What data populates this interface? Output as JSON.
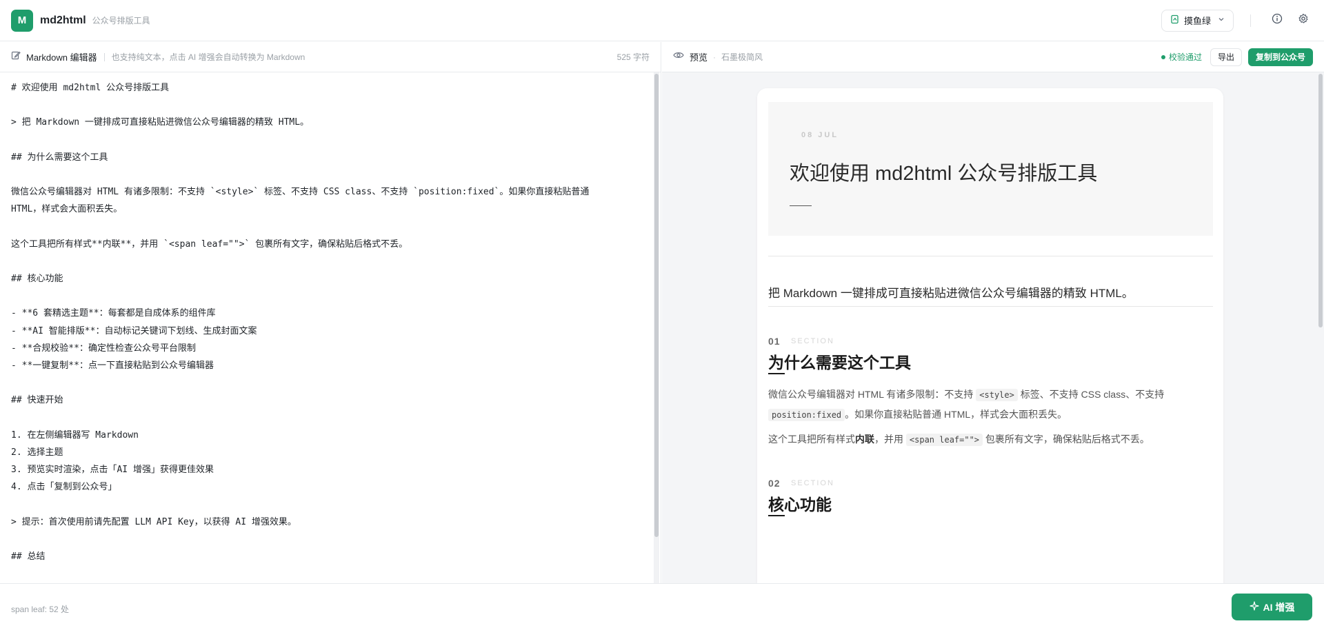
{
  "app": {
    "logo_letter": "M",
    "name": "md2html",
    "subtitle": "公众号排版工具"
  },
  "topbar": {
    "theme_label": "摸鱼绿",
    "icons": [
      "theme-palette-icon",
      "chevron-down-icon",
      "info-icon",
      "gear-icon"
    ]
  },
  "editor": {
    "title": "Markdown 编辑器",
    "hint": "也支持纯文本，点击 AI 增强会自动转换为 Markdown",
    "char_count": "525 字符",
    "lines": [
      "# 欢迎使用 md2html 公众号排版工具",
      "",
      "> 把 Markdown 一键排成可直接粘贴进微信公众号编辑器的精致 HTML。",
      "",
      "## 为什么需要这个工具",
      "",
      "微信公众号编辑器对 HTML 有诸多限制：不支持 `<style>` 标签、不支持 CSS class、不支持 `position:fixed`。如果你直接粘贴普通",
      "HTML，样式会大面积丢失。",
      "",
      "这个工具把所有样式**内联**，并用 `<span leaf=\"\">` 包裹所有文字，确保粘贴后格式不丢。",
      "",
      "## 核心功能",
      "",
      "- **6 套精选主题**：每套都是自成体系的组件库",
      "- **AI 智能排版**：自动标记关键词下划线、生成封面文案",
      "- **合规校验**：确定性检查公众号平台限制",
      "- **一键复制**：点一下直接粘贴到公众号编辑器",
      "",
      "## 快速开始",
      "",
      "1. 在左侧编辑器写 Markdown",
      "2. 选择主题",
      "3. 预览实时渲染，点击「AI 增强」获得更佳效果",
      "4. 点击「复制到公众号」",
      "",
      "> 提示：首次使用前请先配置 LLM API Key，以获得 AI 增强效果。",
      "",
      "## 总结"
    ]
  },
  "preview": {
    "title": "预览",
    "theme_name": "石墨极简风",
    "validation": "校验通过",
    "export_label": "导出",
    "copy_label": "复制到公众号",
    "article": {
      "date": "08 JUL",
      "title": "欢迎使用 md2html 公众号排版工具",
      "lead": "把 Markdown 一键排成可直接粘贴进微信公众号编辑器的精致 HTML。",
      "sections": [
        {
          "num": "01",
          "tag": "SECTION",
          "title": "为什么需要这个工具",
          "p1_a": "微信公众号编辑器对 HTML 有诸多限制：不支持 ",
          "p1_code1": "<style>",
          "p1_b": " 标签、不支持 CSS class、不支持",
          "p1_code2": "position:fixed",
          "p1_c": "。如果你直接粘贴普通 HTML，样式会大面积丢失。",
          "p2_a": "这个工具把所有样式",
          "p2_bold": "内联",
          "p2_b": "，并用 ",
          "p2_code": "<span leaf=\"\">",
          "p2_c": " 包裹所有文字，确保粘贴后格式不丢。"
        },
        {
          "num": "02",
          "tag": "SECTION",
          "title": "核心功能"
        }
      ]
    }
  },
  "footer": {
    "status": "span leaf: 52 处",
    "ai_label": "AI 增强"
  },
  "colors": {
    "accent": "#1f9d6b",
    "border": "#e8eaed",
    "preview_bg": "#f4f5f7"
  }
}
